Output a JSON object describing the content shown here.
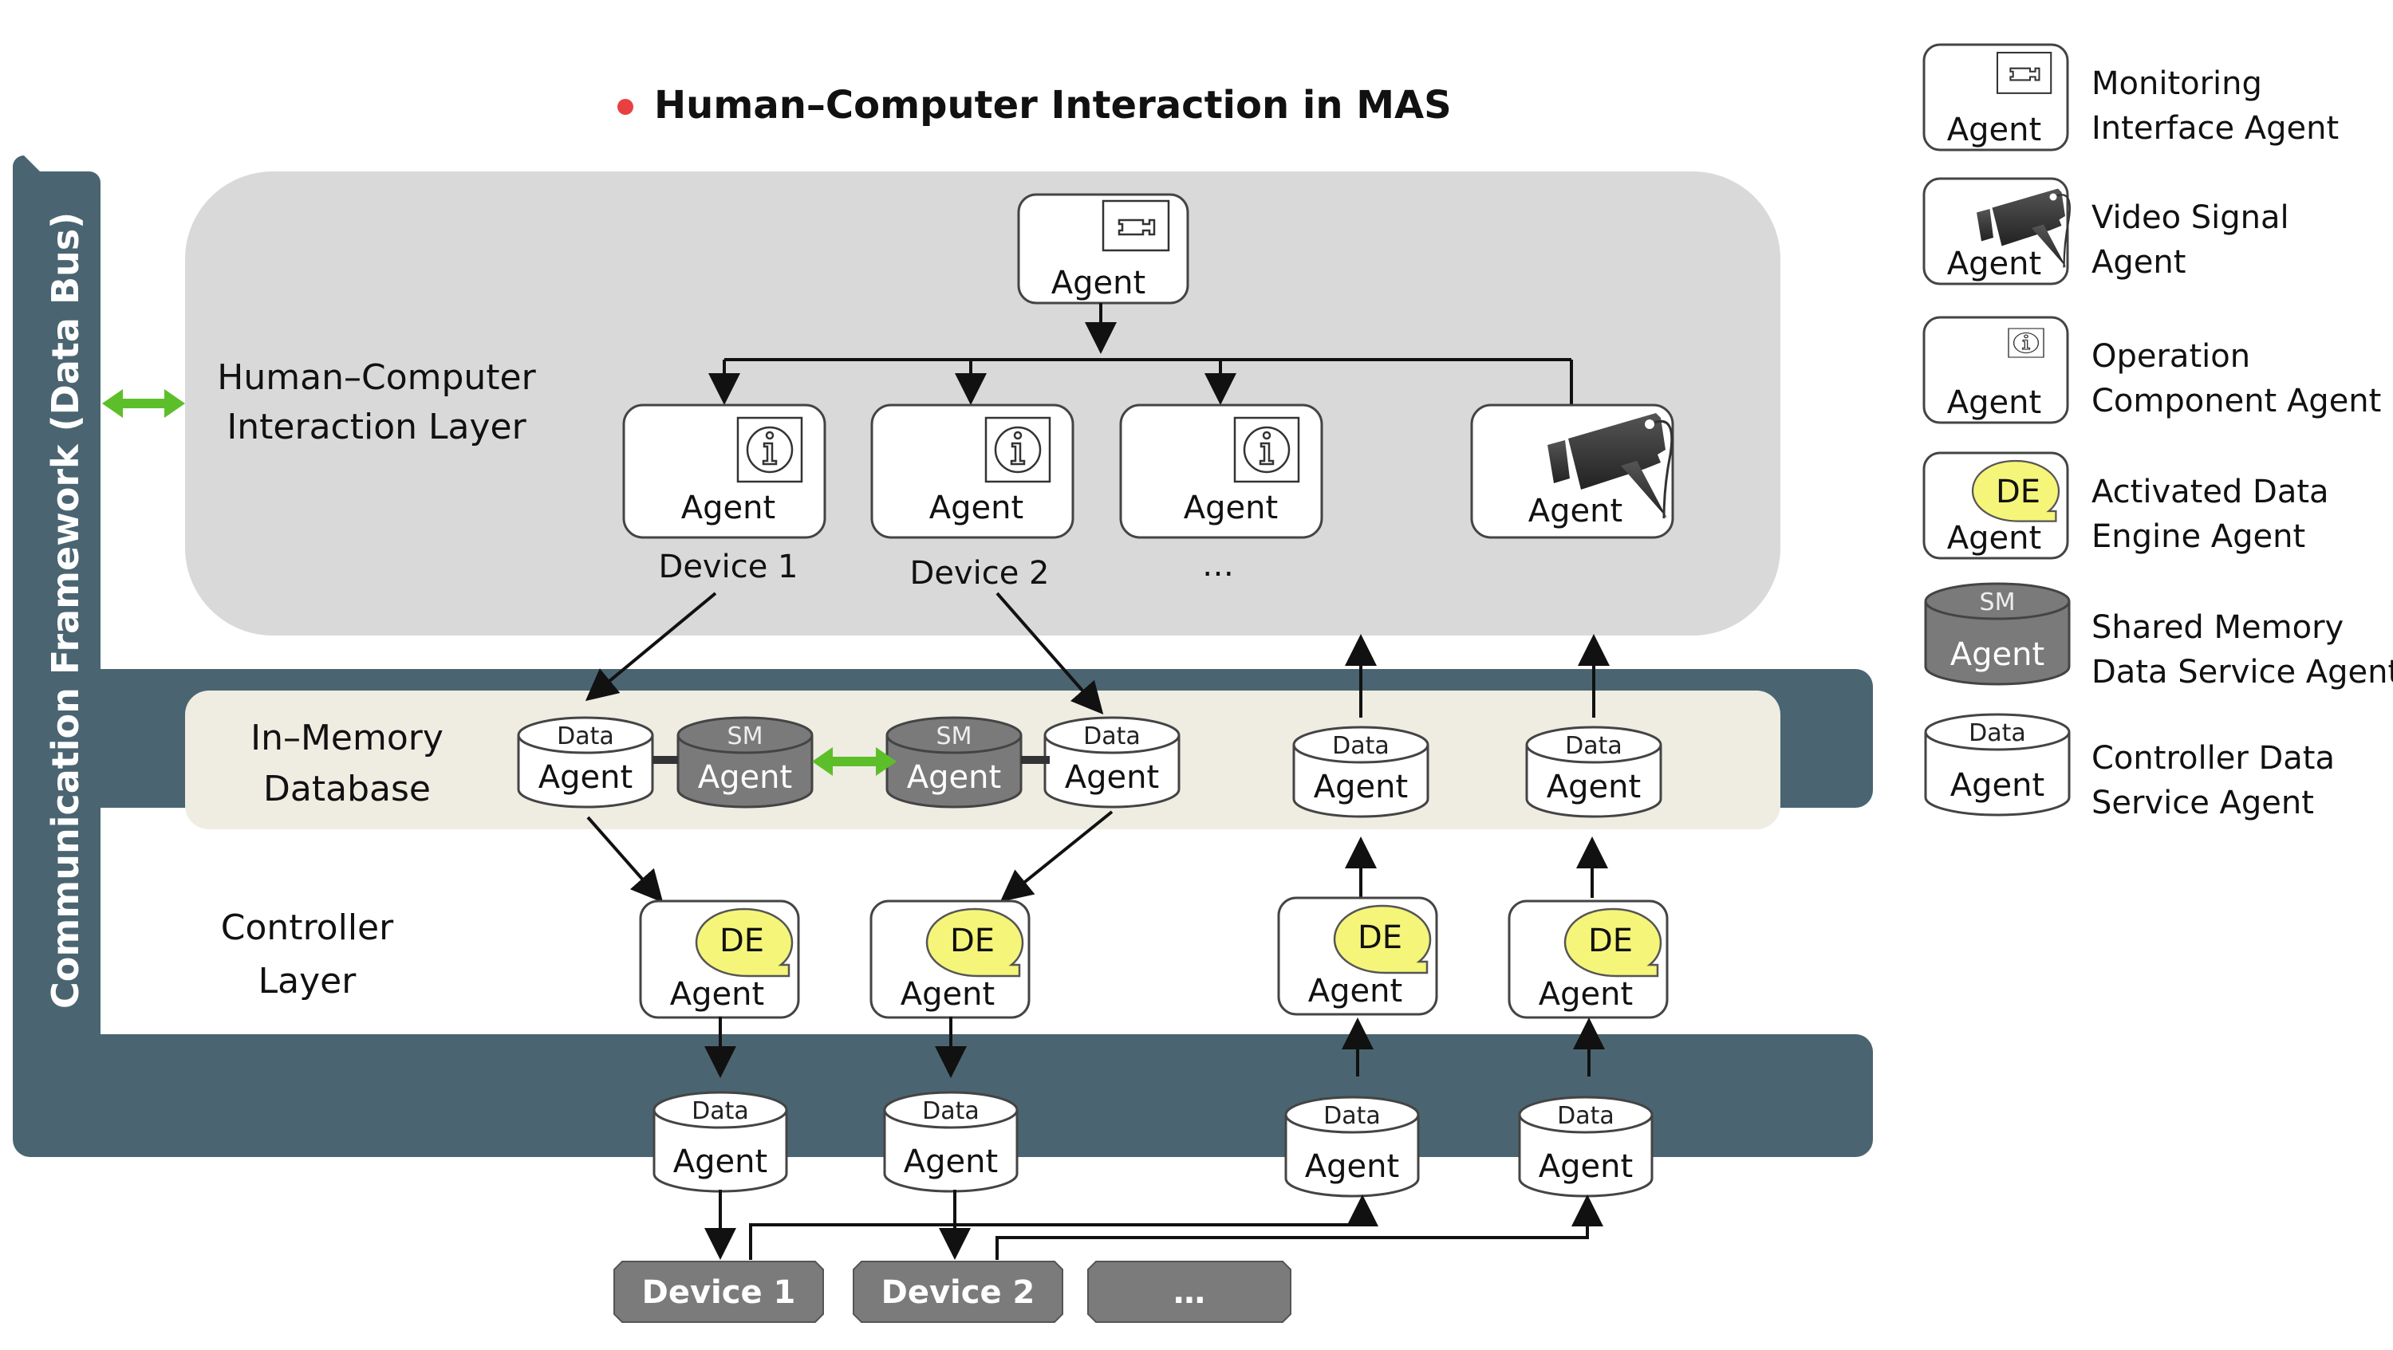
{
  "title": "Human–Computer Interaction in MAS",
  "colors": {
    "bullet": "#e84040",
    "data_bus": "#4a6571",
    "hci_layer_bg": "#d9d9d9",
    "imdb_bg": "#efece2",
    "sm_agent_fill": "#7a7a7a",
    "de_bubble": "#f5f57a",
    "device_fill": "#7b7b7b",
    "bidirectional_arrow": "#5cbf2a"
  },
  "data_bus": {
    "label": "Communication Framework (Data Bus)"
  },
  "layers": {
    "hci": {
      "line1": "Human–Computer",
      "line2": "Interaction Layer"
    },
    "imdb": {
      "line1": "In–Memory",
      "line2": "Database"
    },
    "controller": {
      "line1": "Controller",
      "line2": "Layer"
    }
  },
  "hci_agents": {
    "monitoring": {
      "label": "Agent",
      "icon": "monitor-camera-icon"
    },
    "operation": [
      {
        "label": "Agent",
        "caption": "Device 1",
        "icon": "info-icon"
      },
      {
        "label": "Agent",
        "caption": "Device 2",
        "icon": "info-icon"
      },
      {
        "label": "Agent",
        "caption": "…",
        "icon": "info-icon"
      }
    ],
    "video": {
      "label": "Agent",
      "icon": "video-camera-icon"
    }
  },
  "imdb_agents": [
    {
      "type": "data",
      "top": "Data",
      "label": "Agent"
    },
    {
      "type": "sm",
      "top": "SM",
      "label": "Agent"
    },
    {
      "type": "sm",
      "top": "SM",
      "label": "Agent"
    },
    {
      "type": "data",
      "top": "Data",
      "label": "Agent"
    },
    {
      "type": "data",
      "top": "Data",
      "label": "Agent"
    },
    {
      "type": "data",
      "top": "Data",
      "label": "Agent"
    }
  ],
  "controller_agents": [
    {
      "badge": "DE",
      "label": "Agent"
    },
    {
      "badge": "DE",
      "label": "Agent"
    },
    {
      "badge": "DE",
      "label": "Agent"
    },
    {
      "badge": "DE",
      "label": "Agent"
    }
  ],
  "bus_agents": [
    {
      "top": "Data",
      "label": "Agent"
    },
    {
      "top": "Data",
      "label": "Agent"
    },
    {
      "top": "Data",
      "label": "Agent"
    },
    {
      "top": "Data",
      "label": "Agent"
    }
  ],
  "devices": [
    "Device 1",
    "Device 2",
    "…"
  ],
  "legend": [
    {
      "icon": "monitor-camera-icon",
      "label": "Agent",
      "line1": "Monitoring",
      "line2": "Interface Agent"
    },
    {
      "icon": "video-camera-icon",
      "label": "Agent",
      "line1": "Video Signal",
      "line2": "Agent"
    },
    {
      "icon": "info-icon",
      "label": "Agent",
      "line1": "Operation",
      "line2": "Component Agent"
    },
    {
      "icon": "de-bubble-icon",
      "badge": "DE",
      "label": "Agent",
      "line1": "Activated Data",
      "line2": "Engine Agent"
    },
    {
      "icon": "sm-cylinder-icon",
      "top": "SM",
      "label": "Agent",
      "line1": "Shared Memory",
      "line2": "Data Service Agent"
    },
    {
      "icon": "data-cylinder-icon",
      "top": "Data",
      "label": "Agent",
      "line1": "Controller Data",
      "line2": "Service Agent"
    }
  ]
}
